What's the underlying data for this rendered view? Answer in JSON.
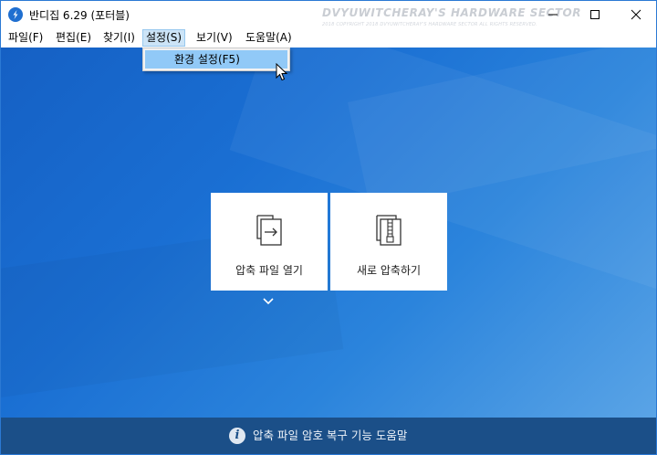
{
  "window": {
    "title": "반디집 6.29 (포터블)",
    "watermark": "DVYUWITCHERAY'S HARDWARE SECTOR",
    "watermark_sub": "2018 COPYRIGHT 2018 DVYUWITCHERAY'S HARDWARE SECTOR ALL RIGHTS RESERVED."
  },
  "menubar": {
    "items": [
      {
        "label": "파일(F)"
      },
      {
        "label": "편집(E)"
      },
      {
        "label": "찾기(I)"
      },
      {
        "label": "설정(S)",
        "active": true
      },
      {
        "label": "보기(V)"
      },
      {
        "label": "도움말(A)"
      }
    ]
  },
  "dropdown": {
    "items": [
      {
        "label": "환경 설정(F5)",
        "highlighted": true
      }
    ]
  },
  "cards": {
    "open_archive": {
      "label": "압축 파일 열기",
      "icon": "file-open-arrow-icon"
    },
    "new_archive": {
      "label": "새로 압축하기",
      "icon": "zip-archive-icon"
    }
  },
  "footer": {
    "text": "압축 파일 암호 복구 기능 도움말",
    "icon": "info-icon"
  },
  "colors": {
    "background_start": "#1560c4",
    "background_end": "#5aa4e6",
    "footer": "#1b4f88",
    "menu_highlight": "#91c9f7"
  }
}
